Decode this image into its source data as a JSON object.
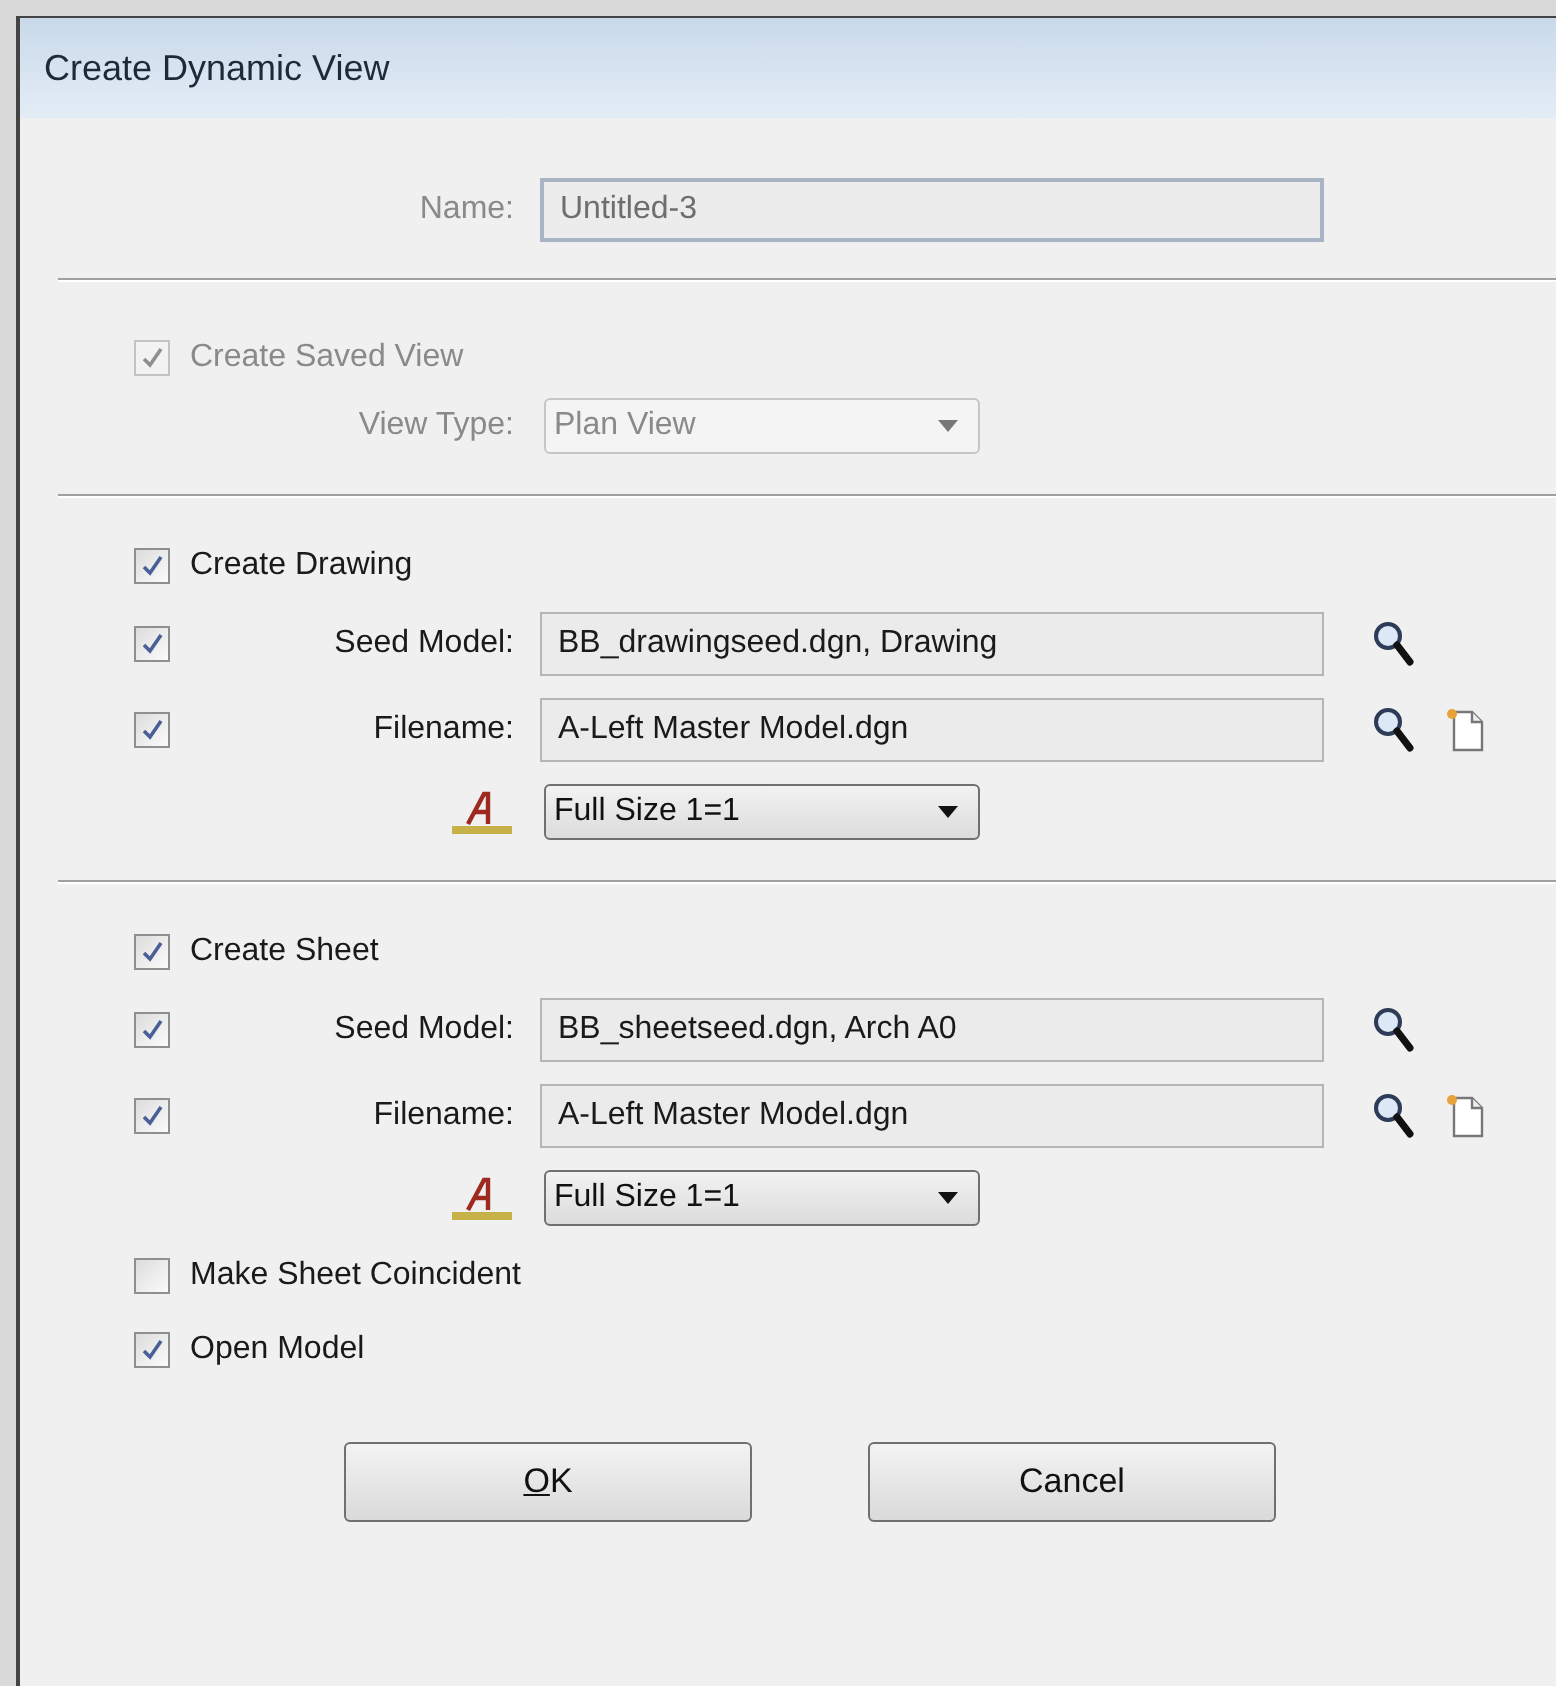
{
  "window": {
    "title": "Create Dynamic View"
  },
  "name_field": {
    "label": "Name:",
    "value": "Untitled-3",
    "disabled": true
  },
  "saved_view": {
    "checkbox": {
      "label": "Create Saved View",
      "checked": true,
      "disabled": true
    },
    "view_type": {
      "label": "View Type:",
      "value": "Plan View",
      "disabled": true
    }
  },
  "sections": [
    {
      "checkbox": {
        "label": "Create Drawing",
        "checked": true
      },
      "rows": [
        {
          "kind": "field",
          "checked": true,
          "label": "Seed Model:",
          "value": "BB_drawingseed.dgn, Drawing",
          "browse": true,
          "new_file": false
        },
        {
          "kind": "field",
          "checked": true,
          "label": "Filename:",
          "value": "A-Left Master Model.dgn",
          "browse": true,
          "new_file": true
        },
        {
          "kind": "scale",
          "value": "Full Size 1=1"
        }
      ]
    },
    {
      "checkbox": {
        "label": "Create Sheet",
        "checked": true
      },
      "rows": [
        {
          "kind": "field",
          "checked": true,
          "label": "Seed Model:",
          "value": "BB_sheetseed.dgn, Arch A0",
          "browse": true,
          "new_file": false
        },
        {
          "kind": "field",
          "checked": true,
          "label": "Filename:",
          "value": "A-Left Master Model.dgn",
          "browse": true,
          "new_file": true
        },
        {
          "kind": "scale",
          "value": "Full Size 1=1"
        }
      ]
    }
  ],
  "options": [
    {
      "label": "Make Sheet Coincident",
      "checked": false
    },
    {
      "label": "Open Model",
      "checked": true
    }
  ],
  "buttons": [
    {
      "label": "OK",
      "first_letter_underlined": true
    },
    {
      "label": "Cancel"
    }
  ]
}
